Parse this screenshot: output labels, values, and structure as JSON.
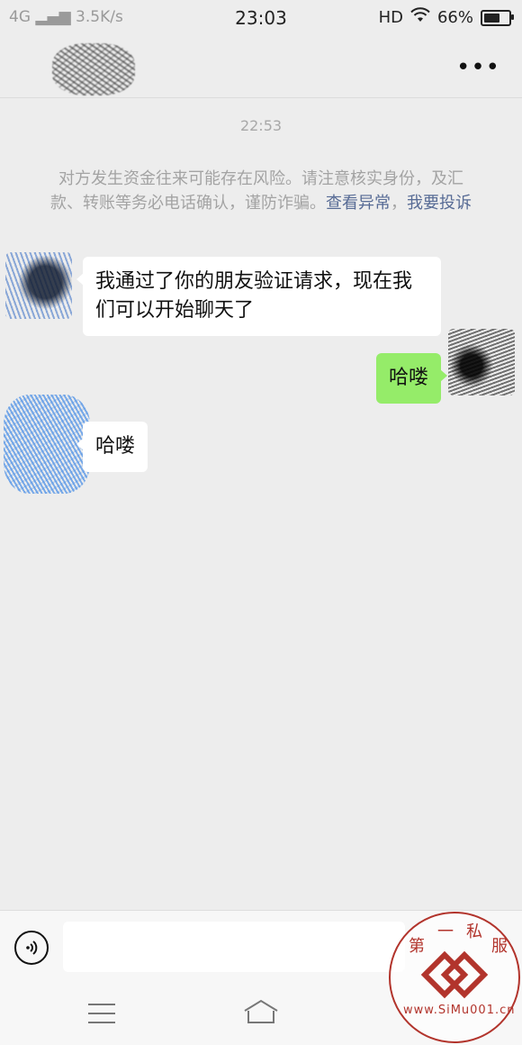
{
  "status_bar": {
    "network": "4G",
    "speed": "3.5K/s",
    "time": "23:03",
    "hd": "HD",
    "battery": "66%",
    "battery_level": 0.66
  },
  "header": {
    "more_icon": "more-dots-icon"
  },
  "chat": {
    "time_divider": "22:53",
    "risk_notice": {
      "text": "对方发生资金往来可能存在风险。请注意核实身份，及汇款、转账等务必电话确认，谨防诈骗。",
      "link_abnormal": "查看异常",
      "separator": "，",
      "link_report": "我要投诉"
    },
    "messages": [
      {
        "side": "in",
        "text": "我通过了你的朋友验证请求，现在我们可以开始聊天了"
      },
      {
        "side": "out",
        "text": "哈喽"
      },
      {
        "side": "in",
        "text": "哈喽"
      }
    ]
  },
  "input_bar": {
    "voice_icon": "voice-icon",
    "placeholder": ""
  },
  "nav_bar": {
    "menu_icon": "menu-icon",
    "home_icon": "home-icon"
  },
  "watermark": {
    "chars": [
      "第",
      "一",
      "私",
      "服"
    ],
    "url": "www.SiMu001.cn"
  },
  "colors": {
    "background": "#ededed",
    "outgoing_bubble": "#95ec69",
    "incoming_bubble": "#ffffff",
    "link": "#576b95",
    "watermark": "#b2342c"
  }
}
